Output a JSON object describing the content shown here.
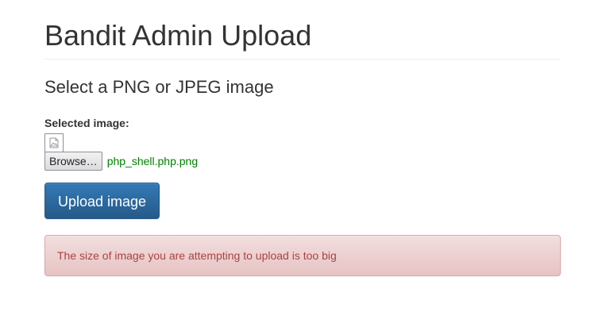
{
  "page": {
    "title": "Bandit Admin Upload",
    "subtitle": "Select a PNG or JPEG image"
  },
  "form": {
    "selected_label": "Selected image:",
    "preview_icon": "broken-image-icon",
    "browse_label": "Browse…",
    "file_name": "php_shell.php.png",
    "upload_label": "Upload image"
  },
  "alert": {
    "message": "The size of image you are attempting to upload is too big"
  },
  "colors": {
    "primary": "#337ab7",
    "danger_text": "#a94442",
    "danger_bg": "#f2dede",
    "file_name": "#008000"
  }
}
